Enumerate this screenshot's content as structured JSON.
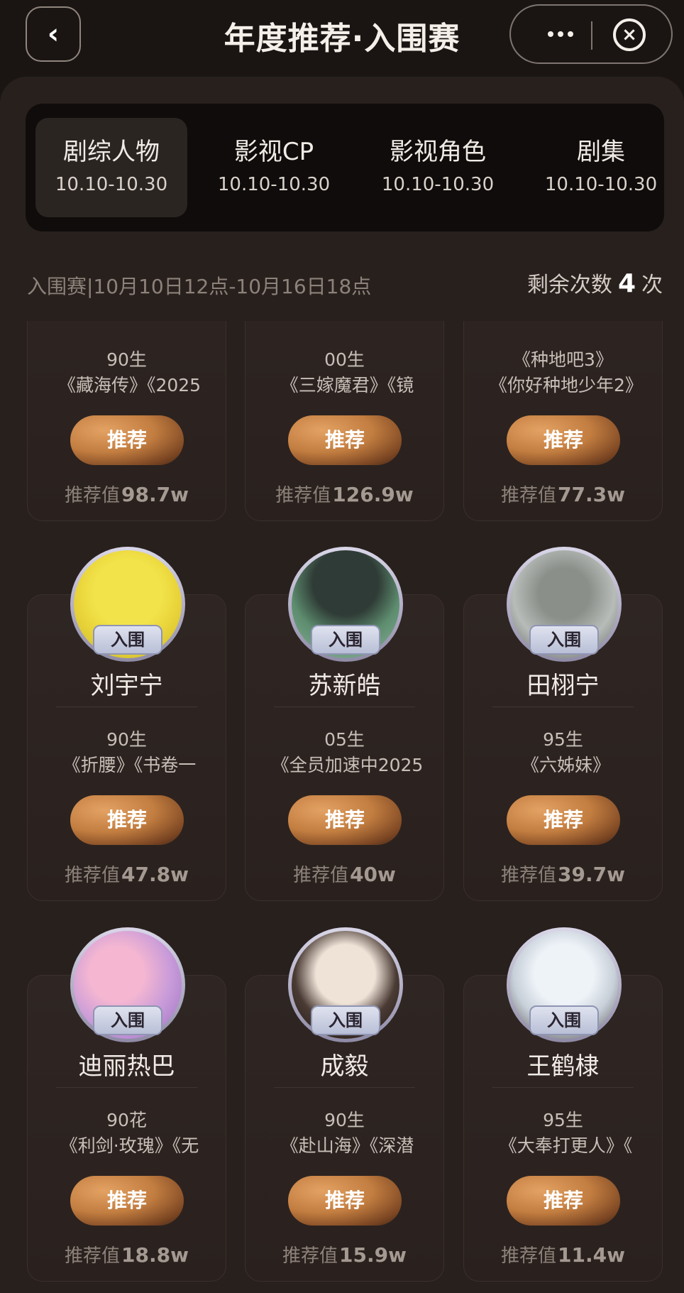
{
  "header": {
    "title": "年度推荐·入围赛"
  },
  "tabs": [
    {
      "label": "剧综人物",
      "date": "10.10-10.30"
    },
    {
      "label": "影视CP",
      "date": "10.10-10.30"
    },
    {
      "label": "影视角色",
      "date": "10.10-10.30"
    },
    {
      "label": "剧集",
      "date": "10.10-10.30"
    }
  ],
  "info": {
    "round_text": "入围赛|10月10日12点-10月16日18点",
    "remaining_label": "剩余次数",
    "remaining_count": "4",
    "remaining_unit": "次"
  },
  "cards": [
    {
      "gen": "90生",
      "works": "《藏海传》《2025",
      "button": "推荐",
      "value_label": "推荐值",
      "value": "98.7w"
    },
    {
      "gen": "00生",
      "works": "《三嫁魔君》《镜",
      "button": "推荐",
      "value_label": "推荐值",
      "value": "126.9w"
    },
    {
      "gen": "《种地吧3》",
      "works": "《你好种地少年2》",
      "button": "推荐",
      "value_label": "推荐值",
      "value": "77.3w"
    },
    {
      "badge": "入围",
      "name": "刘宇宁",
      "gen": "90生",
      "works": "《折腰》《书卷一",
      "button": "推荐",
      "value_label": "推荐值",
      "value": "47.8w"
    },
    {
      "badge": "入围",
      "name": "苏新皓",
      "gen": "05生",
      "works": "《全员加速中2025",
      "button": "推荐",
      "value_label": "推荐值",
      "value": "40w"
    },
    {
      "badge": "入围",
      "name": "田栩宁",
      "gen": "95生",
      "works": "《六姊妹》",
      "button": "推荐",
      "value_label": "推荐值",
      "value": "39.7w"
    },
    {
      "badge": "入围",
      "name": "迪丽热巴",
      "gen": "90花",
      "works": "《利剑·玫瑰》《无",
      "button": "推荐",
      "value_label": "推荐值",
      "value": "18.8w"
    },
    {
      "badge": "入围",
      "name": "成毅",
      "gen": "90生",
      "works": "《赴山海》《深潜",
      "button": "推荐",
      "value_label": "推荐值",
      "value": "15.9w"
    },
    {
      "badge": "入围",
      "name": "王鹤棣",
      "gen": "95生",
      "works": "《大奉打更人》《",
      "button": "推荐",
      "value_label": "推荐值",
      "value": "11.4w"
    }
  ]
}
